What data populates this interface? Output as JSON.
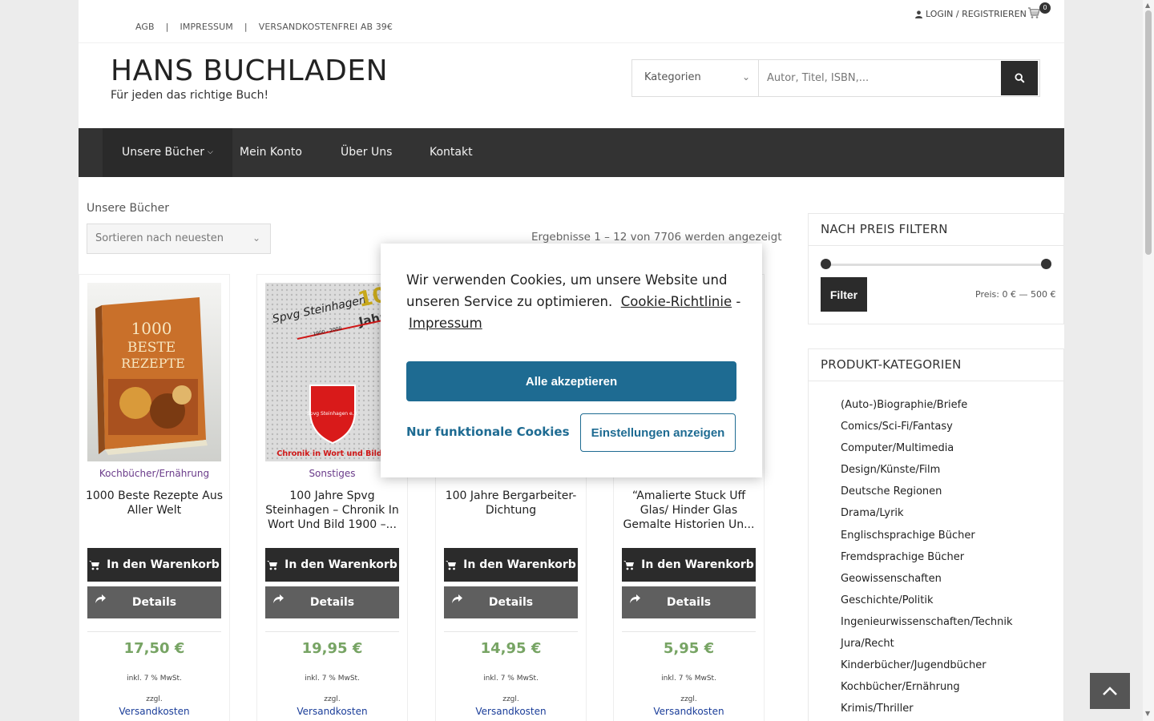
{
  "topbar": {
    "links": [
      "AGB",
      "IMPRESSUM",
      "VERSANDKOSTENFREI AB 39€"
    ],
    "separator": "|",
    "login_label": "LOGIN / REGISTRIEREN",
    "cart_count": "0"
  },
  "header": {
    "site_title": "HANS BUCHLADEN",
    "tagline": "Für jeden das richtige Buch!"
  },
  "search": {
    "category_label": "Kategorien",
    "placeholder": "Autor, Titel, ISBN,..."
  },
  "nav": {
    "items": [
      "Unsere Bücher",
      "Mein Konto",
      "Über Uns",
      "Kontakt"
    ],
    "active": "Unsere Bücher"
  },
  "content": {
    "breadcrumb": "Unsere Bücher",
    "sort_label": "Sortieren nach neuesten",
    "result_count": "Ergebnisse 1 – 12 von 7706 werden angezeigt"
  },
  "products": [
    {
      "category": "Kochbücher/Ernährung",
      "title": "1000 Beste Rezepte Aus Aller Welt",
      "price": "17,50",
      "currency": "€"
    },
    {
      "category": "Sonstiges",
      "title": "100 Jahre Spvg Steinhagen – Chronik In Wort Und Bild 1900 –...",
      "price": "19,95",
      "currency": "€"
    },
    {
      "category": "",
      "title": "100 Jahre Bergarbeiter-Dichtung",
      "price": "14,95",
      "currency": "€"
    },
    {
      "category": "",
      "title": "“Amalierte Stuck Uff Glas/ Hinder Glas Gemalte Historien Un...",
      "price": "5,95",
      "currency": "€"
    }
  ],
  "product_labels": {
    "cart_button": "In den Warenkorb",
    "details_button": "Details",
    "vat": "inkl. 7 % MwSt.",
    "zzgl": "zzgl.",
    "shipping": "Versandkosten"
  },
  "cover_text": {
    "book1_line1": "1000",
    "book1_line2": "BESTE",
    "book1_line3": "REZEPTE",
    "book2_top": "Spvg Steinhagen",
    "book2_big": "100",
    "book2_jahre": "Jahre",
    "book2_years": "1900 - 2000",
    "book2_badge": "Spvg Steinhagen e.V.",
    "book2_bottom": "Chronik in Wort und Bild"
  },
  "sidebar": {
    "price_filter": {
      "title": "NACH PREIS FILTERN",
      "button": "Filter",
      "range_label": "Preis: 0 € — 500 €",
      "min": 0,
      "max": 500
    },
    "categories": {
      "title": "PRODUKT-KATEGORIEN",
      "items": [
        "(Auto-)Biographie/Briefe",
        "Comics/Sci-Fi/Fantasy",
        "Computer/Multimedia",
        "Design/Künste/Film",
        "Deutsche Regionen",
        "Drama/Lyrik",
        "Englischsprachige Bücher",
        "Fremdsprachige Bücher",
        "Geowissenschaften",
        "Geschichte/Politik",
        "Ingenieurwissenschaften/Technik",
        "Jura/Recht",
        "Kinderbücher/Jugendbücher",
        "Kochbücher/Ernährung",
        "Krimis/Thriller"
      ]
    }
  },
  "cookie": {
    "text": "Wir verwenden Cookies, um unsere Website und unseren Service zu optimieren.",
    "policy_link": "Cookie-Richtlinie",
    "dash": "-",
    "impressum_link": "Impressum",
    "accept_all": "Alle akzeptieren",
    "functional_only": "Nur funktionale Cookies",
    "show_settings": "Einstellungen anzeigen"
  },
  "colors": {
    "nav_bg": "#333333",
    "price_green": "#77a464",
    "cookie_blue": "#1e6b92",
    "category_purple": "#6a3b8a",
    "shipping_blue": "#1a3d99"
  }
}
